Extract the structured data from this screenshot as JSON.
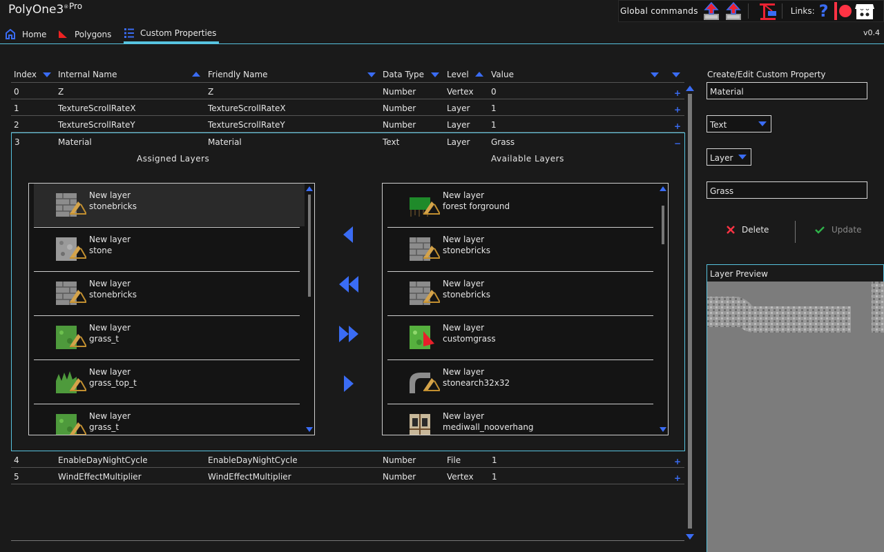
{
  "app": {
    "name": "PolyOne3",
    "reg": "®",
    "edition": "Pro",
    "version": "v0.4"
  },
  "global": {
    "label": "Global commands",
    "links_label": "Links:"
  },
  "tabs": [
    {
      "label": "Home",
      "icon": "home-icon"
    },
    {
      "label": "Polygons",
      "icon": "polygon-icon"
    },
    {
      "label": "Custom Properties",
      "icon": "list-icon",
      "active": true
    }
  ],
  "table": {
    "headers": {
      "index": "Index",
      "internal": "Internal Name",
      "friendly": "Friendly Name",
      "type": "Data Type",
      "level": "Level",
      "value": "Value"
    },
    "rows": [
      {
        "index": "0",
        "internal": "Z",
        "friendly": "Z",
        "type": "Number",
        "level": "Vertex",
        "value": "0"
      },
      {
        "index": "1",
        "internal": "TextureScrollRateX",
        "friendly": "TextureScrollRateX",
        "type": "Number",
        "level": "Layer",
        "value": "1"
      },
      {
        "index": "2",
        "internal": "TextureScrollRateY",
        "friendly": "TextureScrollRateY",
        "type": "Number",
        "level": "Layer",
        "value": "1"
      },
      {
        "index": "3",
        "internal": "Material",
        "friendly": "Material",
        "type": "Text",
        "level": "Layer",
        "value": "Grass"
      },
      {
        "index": "4",
        "internal": "EnableDayNightCycle",
        "friendly": "EnableDayNightCycle",
        "type": "Number",
        "level": "File",
        "value": "1"
      },
      {
        "index": "5",
        "internal": "WindEffectMultiplier",
        "friendly": "WindEffectMultiplier",
        "type": "Number",
        "level": "Vertex",
        "value": "1"
      }
    ]
  },
  "expanded": {
    "assigned_label": "Assigned Layers",
    "available_label": "Available Layers",
    "assigned": [
      {
        "name": "New layer",
        "texture": "stonebricks",
        "thumb": "brick"
      },
      {
        "name": "New layer",
        "texture": "stone",
        "thumb": "stone"
      },
      {
        "name": "New layer",
        "texture": "stonebricks",
        "thumb": "brick"
      },
      {
        "name": "New layer",
        "texture": "grass_t",
        "thumb": "grass"
      },
      {
        "name": "New layer",
        "texture": "grass_top_t",
        "thumb": "grasstop"
      },
      {
        "name": "New layer",
        "texture": "grass_t",
        "thumb": "grass"
      }
    ],
    "available": [
      {
        "name": "New layer",
        "texture": "forest forground",
        "thumb": "forest"
      },
      {
        "name": "New layer",
        "texture": "stonebricks",
        "thumb": "brick"
      },
      {
        "name": "New layer",
        "texture": "stonebricks",
        "thumb": "brick"
      },
      {
        "name": "New layer",
        "texture": "customgrass",
        "thumb": "customgrass"
      },
      {
        "name": "New layer",
        "texture": "stonearch32x32",
        "thumb": "arch"
      },
      {
        "name": "New layer",
        "texture": "mediwall_nooverhang",
        "thumb": "wall"
      }
    ]
  },
  "editor": {
    "title": "Create/Edit Custom Property",
    "name_value": "Material",
    "type_value": "Text",
    "level_value": "Layer",
    "value_value": "Grass",
    "delete_label": "Delete",
    "update_label": "Update",
    "preview_label": "Layer Preview"
  },
  "colors": {
    "accent": "#57c4e0",
    "blue": "#3a6cf4",
    "red": "#ff3344",
    "green": "#2fb24a"
  }
}
